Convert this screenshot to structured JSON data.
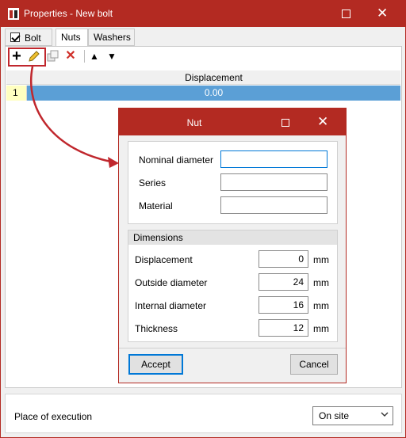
{
  "window": {
    "title": "Properties - New bolt"
  },
  "tabs": [
    {
      "label": "Bolt",
      "checked": true
    },
    {
      "label": "Nuts"
    },
    {
      "label": "Washers"
    }
  ],
  "toolbar": {
    "icons": [
      "plus-icon",
      "pencil-icon",
      "copy-icon",
      "delete-icon",
      "arrow-up-icon",
      "arrow-down-icon"
    ],
    "plus_glyph": "+",
    "delete_glyph": "✕",
    "up_glyph": "▲",
    "down_glyph": "▼"
  },
  "grid": {
    "columns": [
      "Displacement"
    ],
    "rows": [
      {
        "index": "1",
        "displacement": "0.00"
      }
    ]
  },
  "bottom": {
    "place_label": "Place of execution",
    "place_value": "On site"
  },
  "nut_dialog": {
    "title": "Nut",
    "fields": {
      "nominal_diameter_label": "Nominal diameter",
      "series_label": "Series",
      "material_label": "Material"
    },
    "dimensions": {
      "title": "Dimensions",
      "rows": [
        {
          "label": "Displacement",
          "value": "0",
          "unit": "mm"
        },
        {
          "label": "Outside diameter",
          "value": "24",
          "unit": "mm"
        },
        {
          "label": "Internal diameter",
          "value": "16",
          "unit": "mm"
        },
        {
          "label": "Thickness",
          "value": "12",
          "unit": "mm"
        }
      ]
    },
    "accept_label": "Accept",
    "cancel_label": "Cancel"
  },
  "colors": {
    "titlebar": "#b32a22",
    "selection": "#5b9fd6",
    "highlight": "#c0272d"
  }
}
